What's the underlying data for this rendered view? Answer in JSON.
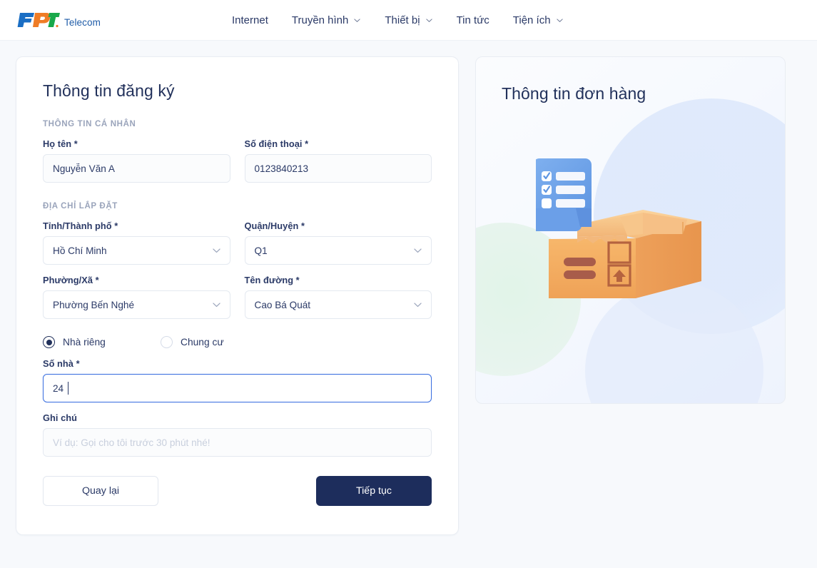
{
  "header": {
    "brand": {
      "logo_icon": "fpt-logo-icon",
      "sub": "Telecom"
    },
    "nav": [
      {
        "label": "Internet",
        "has_chevron": false,
        "icon": ""
      },
      {
        "label": "Truyền hình",
        "has_chevron": true,
        "icon": "chevron-down-icon"
      },
      {
        "label": "Thiết bị",
        "has_chevron": true,
        "icon": "chevron-down-icon"
      },
      {
        "label": "Tin tức",
        "has_chevron": false,
        "icon": ""
      },
      {
        "label": "Tiện ích",
        "has_chevron": true,
        "icon": "chevron-down-icon"
      }
    ]
  },
  "form": {
    "title": "Thông tin đăng ký",
    "sections": {
      "personal": "THÔNG TIN CÁ NHÂN",
      "address": "ĐỊA CHỈ LẮP ĐẶT"
    },
    "fields": {
      "fullname": {
        "label": "Họ tên *",
        "value": "Nguyễn Văn A",
        "placeholder": ""
      },
      "phone": {
        "label": "Số điện thoại *",
        "value": "0123840213",
        "placeholder": ""
      },
      "province": {
        "label": "Tỉnh/Thành phố *",
        "value": "Hồ Chí Minh",
        "icon": "chevron-down-icon"
      },
      "district": {
        "label": "Quận/Huyện *",
        "value": "Q1",
        "icon": "chevron-down-icon"
      },
      "ward": {
        "label": "Phường/Xã *",
        "value": "Phường Bến Nghé",
        "icon": "chevron-down-icon"
      },
      "street": {
        "label": "Tên đường *",
        "value": "Cao Bá Quát",
        "icon": "chevron-down-icon"
      },
      "house_number": {
        "label": "Số nhà *",
        "value": "24",
        "placeholder": "",
        "focused": true
      },
      "note": {
        "label": "Ghi chú",
        "value": "",
        "placeholder": "Ví dụ: Gọi cho tôi trước 30 phút nhé!"
      }
    },
    "housing_type": {
      "options": [
        {
          "label": "Nhà riêng",
          "selected": true
        },
        {
          "label": "Chung cư",
          "selected": false
        }
      ]
    },
    "buttons": {
      "back": "Quay lại",
      "next": "Tiếp tục"
    }
  },
  "order_panel": {
    "title": "Thông tin đơn hàng",
    "illustration_icon": "package-box-checklist-illustration"
  },
  "colors": {
    "page_bg": "#f7f9fc",
    "text_navy": "#2b3a67",
    "heading_navy": "#22315b",
    "primary_button": "#1d2d5c",
    "focus_blue": "#3b6fe0",
    "muted_label": "#9aa4bb",
    "border": "#e4e9f0",
    "box_orange": "#f2a65a",
    "clipboard_blue": "#6fa4ea"
  }
}
